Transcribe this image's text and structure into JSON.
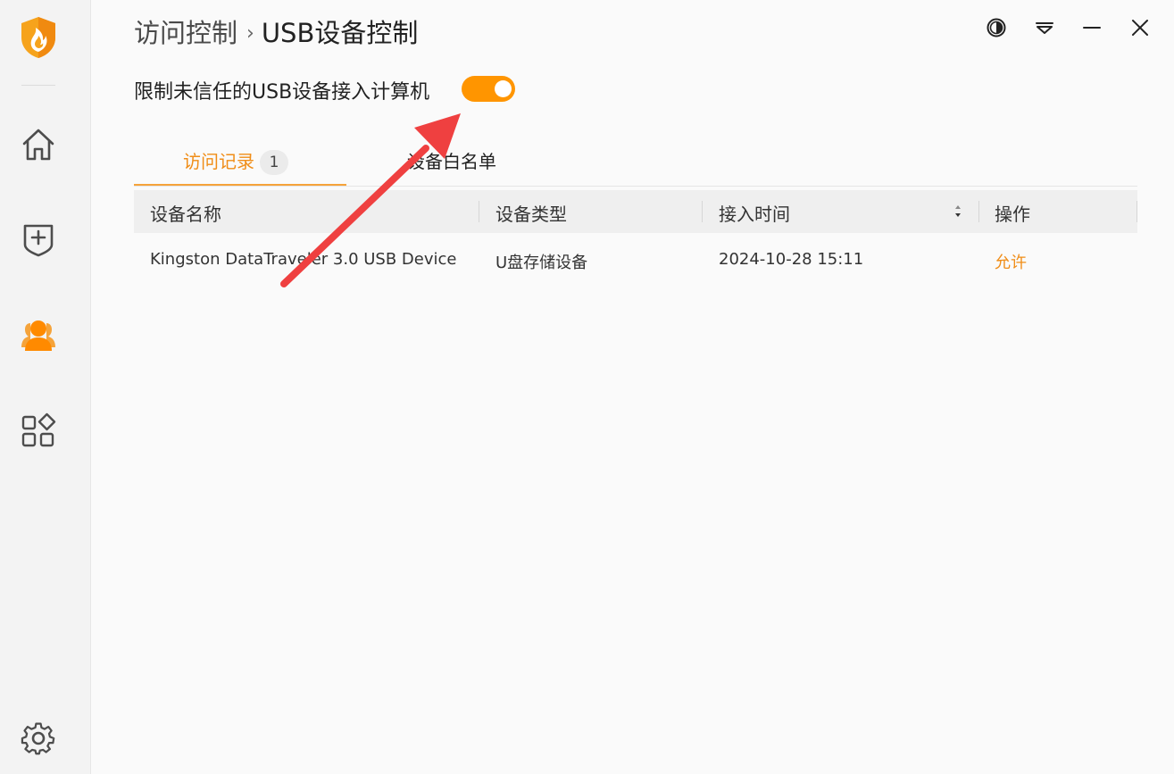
{
  "sidebar": {
    "logo_icon": "flame-shield-logo",
    "items": [
      {
        "icon": "home-icon"
      },
      {
        "icon": "shield-plus-icon"
      },
      {
        "icon": "users-icon",
        "active": true
      },
      {
        "icon": "apps-icon"
      }
    ],
    "settings_icon": "gear-icon"
  },
  "breadcrumb": {
    "parent": "访问控制",
    "separator": "›",
    "current": "USB设备控制"
  },
  "window_controls": [
    "theme-icon",
    "menu-icon",
    "minimize-icon",
    "close-icon"
  ],
  "restrict": {
    "label": "限制未信任的USB设备接入计算机",
    "enabled": true
  },
  "tabs": [
    {
      "label": "访问记录",
      "badge": "1",
      "active": true
    },
    {
      "label": "设备白名单",
      "active": false
    }
  ],
  "table": {
    "columns": [
      "设备名称",
      "设备类型",
      "接入时间",
      "操作"
    ],
    "rows": [
      {
        "name": "Kingston DataTraveler 3.0 USB Device",
        "type": "U盘存储设备",
        "time": "2024-10-28 15:11",
        "action": "允许"
      }
    ]
  },
  "colors": {
    "accent": "#ff9500",
    "accent_text": "#f08d17",
    "annotation_arrow": "#ef4040"
  }
}
